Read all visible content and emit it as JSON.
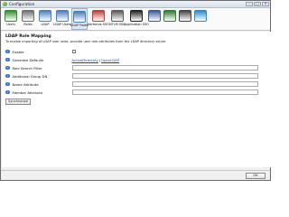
{
  "window": {
    "title": "Configuration",
    "controls": [
      "–",
      "□",
      "✕"
    ]
  },
  "toolbar": {
    "items": [
      {
        "label": "Users",
        "icon": "monitor-icon",
        "color": "#2f8f2f"
      },
      {
        "label": "Roles",
        "icon": "roles-icon",
        "color": "#6f6f6f"
      },
      {
        "label": "LDAP",
        "icon": "ldap-icon",
        "color": "#4a7fbf"
      },
      {
        "label": "LDAP Users",
        "icon": "ldap-users-icon",
        "color": "#4a7fbf"
      },
      {
        "label": "LDAP Roles",
        "icon": "ldap-roles-icon",
        "color": "#4a7fbf",
        "selected": true
      },
      {
        "label": "Kerberos SSO",
        "icon": "kerberos-icon",
        "color": "#c43b3b"
      },
      {
        "label": "NTLM SSO",
        "icon": "ntlm-icon",
        "color": "#5a5a5a"
      },
      {
        "label": "Application SSO",
        "icon": "application-icon",
        "color": "#222222"
      },
      {
        "label": "",
        "icon": "grid-icon",
        "color": "#3a5a9a"
      },
      {
        "label": "",
        "icon": "spellcheck-icon",
        "color": "#2e7d32"
      },
      {
        "label": "",
        "icon": "film-icon",
        "color": "#444444"
      },
      {
        "label": "",
        "icon": "globe-icon",
        "color": "#2a8ad0"
      }
    ]
  },
  "section": {
    "title": "LDAP Role Mapping",
    "description": "To enable importing of LDAP user roles, provide user role attributes from the LDAP directory server."
  },
  "form": {
    "enable_label": "Enable",
    "generate_defaults_label": "Generate Defaults",
    "link_active_directory": "ActiveDirectory",
    "link_separator": "|",
    "link_open_ldap": "OpenLDAP",
    "role_search_filter_label": "Role Search Filter",
    "additional_group_dn_label": "Additional Group DN",
    "name_attribute_label": "Name Attribute",
    "member_attribute_label": "Member Attribute",
    "role_search_filter_value": "",
    "additional_group_dn_value": "",
    "name_attribute_value": "",
    "member_attribute_value": ""
  },
  "buttons": {
    "synchronize": "Synchronize",
    "ok": "OK"
  },
  "help_glyph": "?"
}
